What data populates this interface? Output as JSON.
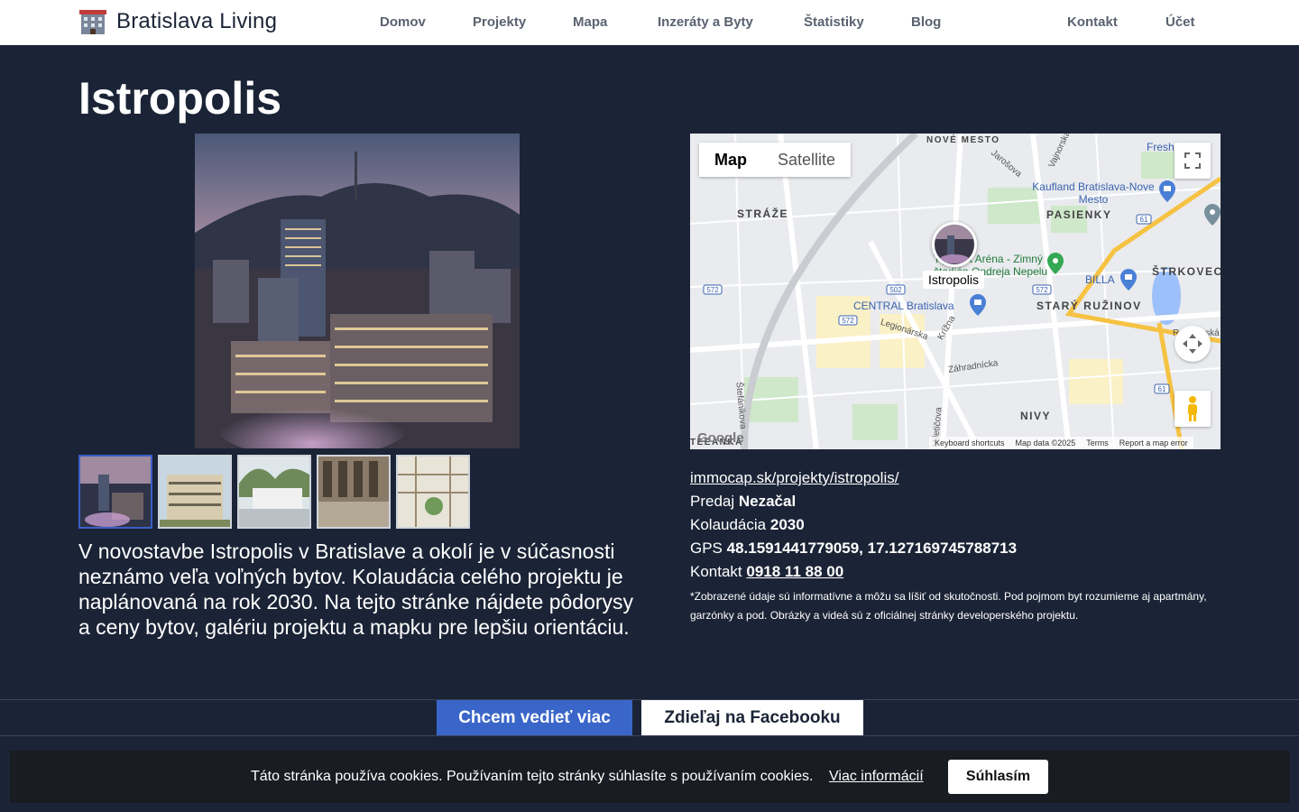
{
  "nav": {
    "brand": "Bratislava Living",
    "links": [
      "Domov",
      "Projekty",
      "Mapa",
      "Inzeráty a Byty",
      "Štatistiky",
      "Blog",
      "Kontakt",
      "Účet"
    ]
  },
  "project": {
    "title": "Istropolis",
    "description": "V novostavbe Istropolis v Bratislave a okolí je v súčasnosti neznámo veľa voľných bytov. Kolaudácia celého projektu je naplánovaná na rok 2030. Na tejto stránke nájdete pôdorysy a ceny bytov, galériu projektu a mapku pre lepšiu orientáciu."
  },
  "gallery": {
    "thumb_count": 5,
    "active_index": 0
  },
  "map": {
    "type_map": "Map",
    "type_satellite": "Satellite",
    "marker_label": "Istropolis",
    "districts": [
      "NOVÉ MESTO",
      "STRÁŽE",
      "PASIENKY",
      "ŠTRKOVEC",
      "STARÝ RUŽINOV",
      "NIVY",
      "TEEANKA"
    ],
    "places": [
      "Tipsport Aréna - Zimný štadión Ondreja Nepelu",
      "CENTRAL Bratislava",
      "Kaufland Bratislava-Nove Mesto",
      "BILLA",
      "Fresh",
      "Legionárska",
      "Krížna",
      "Záhradnícka",
      "Jarošova",
      "Vajnorská",
      "Štefánikova",
      "Ružinovská",
      "Miletičova"
    ],
    "road_numbers": [
      "572",
      "502",
      "572",
      "572",
      "61",
      "61"
    ],
    "google": "Google",
    "footer": [
      "Keyboard shortcuts",
      "Map data ©2025",
      "Terms",
      "Report a map error"
    ]
  },
  "info": {
    "website": "immocap.sk/projekty/istropolis/",
    "sale_label": "Predaj",
    "sale_value": "Nezačal",
    "completion_label": "Kolaudácia",
    "completion_value": "2030",
    "gps_label": "GPS",
    "gps_value": "48.1591441779059, 17.127169745788713",
    "contact_label": "Kontakt",
    "contact_value": "0918 11 88 00",
    "disclaimer": "*Zobrazené údaje sú informatívne a môžu sa líšiť od skutočnosti. Pod pojmom byt rozumieme aj apartmány, garzónky a pod. Obrázky a videá sú z oficiálnej stránky developerského projektu."
  },
  "cta": {
    "more": "Chcem vedieť viac",
    "facebook": "Zdieľaj na Facebooku"
  },
  "cookies": {
    "text": "Táto stránka používa cookies. Používaním tejto stránky súhlasíte s používaním cookies.",
    "more": "Viac informácií",
    "accept": "Súhlasím"
  },
  "colors": {
    "background": "#1b2436",
    "accent": "#3a66c9",
    "nav_text": "#5a6270"
  }
}
